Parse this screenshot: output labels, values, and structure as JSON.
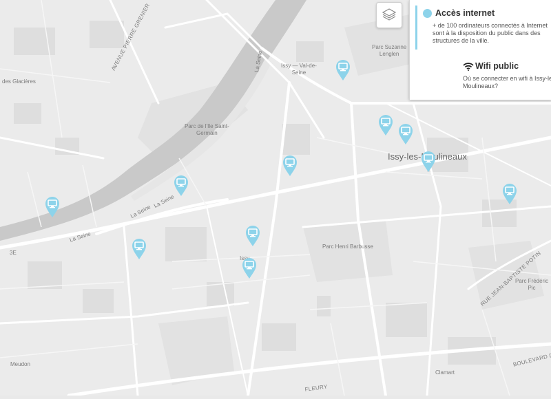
{
  "map": {
    "labels": {
      "glacieres": "des Glacières",
      "avenue_pierre_grenier": "AVENUE PIERRE GRENIER",
      "la_seine_1": "La Seine",
      "la_seine_2": "La Seine",
      "la_seine_3": "La Seine",
      "la_seine_4": "La Seine",
      "issy_val_de_seine": "Issy — Val-de-\nSeine",
      "parc_suzanne_lenglen": "Parc Suzanne\nLenglen",
      "parc_ile_saint_germain": "Parc de l'Ile Saint-\nGermain",
      "issy_les_moulineaux": "Issy-les-Moulineaux",
      "parc_henri_barbusse": "Parc Henri Barbusse",
      "issy": "Issy",
      "rue_jean_baptiste_potin": "RUE JEAN-BAPTISTE POTIN",
      "parc_frederic_pic": "Parc Frédéric\nPic",
      "boulevard": "BOULEVARD DE",
      "meudon": "Meudon",
      "clamart": "Clamart",
      "fleury": "FLEURY",
      "third": "3E"
    }
  },
  "markers": {
    "icon": "computer-monitor-icon",
    "color": "#8dd3ea",
    "count": 11
  },
  "layer_button": {
    "icon": "layers-icon"
  },
  "legend": {
    "internet": {
      "title": "Accès internet",
      "description": "+ de 100 ordinateurs connectés à Internet sont à la disposition du public dans des structures de la ville.",
      "color": "#8dd3ea"
    },
    "wifi": {
      "icon": "wifi-icon",
      "title": "Wifi public",
      "description": "Où se connecter en wifi à Issy-les-Moulineaux?"
    }
  }
}
